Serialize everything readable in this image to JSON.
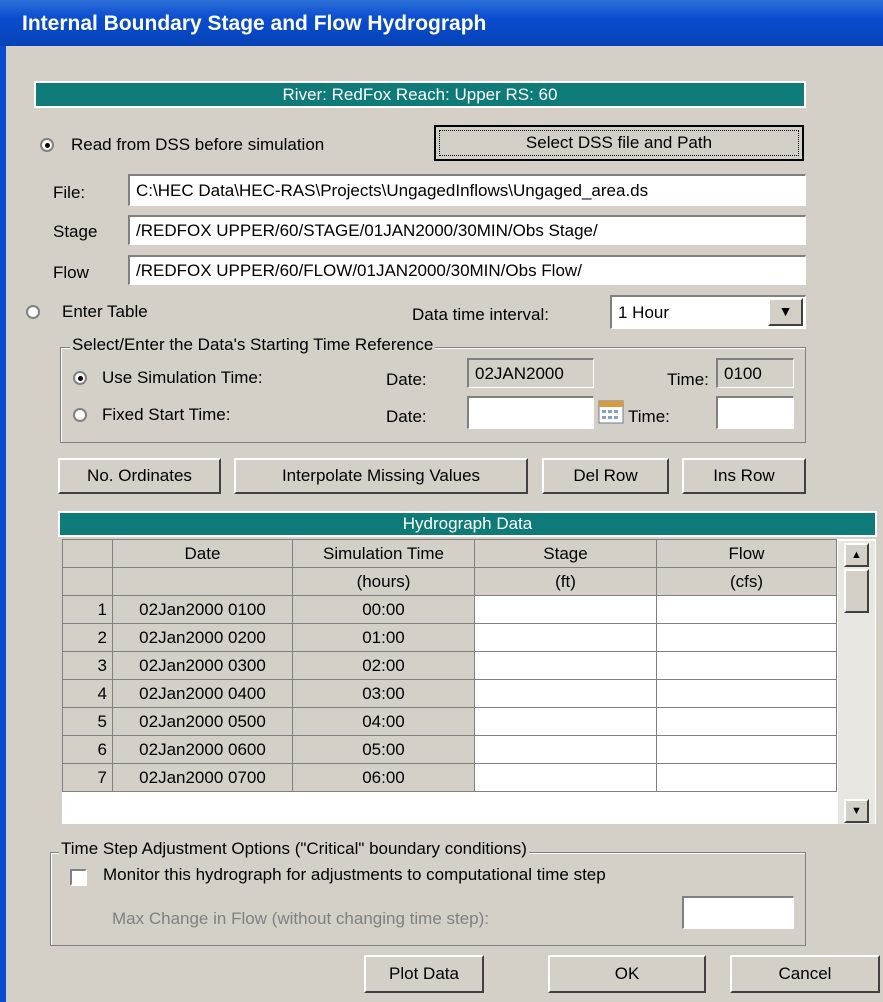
{
  "window": {
    "title": "Internal Boundary Stage and Flow Hydrograph"
  },
  "location_banner": "River: RedFox  Reach: Upper  RS: 60",
  "dss": {
    "radio_label": "Read from DSS before simulation",
    "select_button": "Select DSS file and Path",
    "file_label": "File:",
    "file_value": "C:\\HEC Data\\HEC-RAS\\Projects\\UngagedInflows\\Ungaged_area.ds",
    "stage_label": "Stage",
    "stage_value": "/REDFOX UPPER/60/STAGE/01JAN2000/30MIN/Obs Stage/",
    "flow_label": "Flow",
    "flow_value": "/REDFOX UPPER/60/FLOW/01JAN2000/30MIN/Obs Flow/"
  },
  "table_entry": {
    "radio_label": "Enter Table",
    "interval_label": "Data time interval:",
    "interval_value": "1 Hour"
  },
  "time_ref": {
    "legend": "Select/Enter the Data's Starting Time Reference",
    "use_sim_label": "Use Simulation Time:",
    "fixed_label": "Fixed Start Time:",
    "date_label": "Date:",
    "time_label": "Time:",
    "sim_date": "02JAN2000",
    "sim_time": "0100",
    "fixed_date": "",
    "fixed_time": ""
  },
  "toolbar": {
    "ordinates": "No. Ordinates",
    "interpolate": "Interpolate Missing Values",
    "del_row": "Del Row",
    "ins_row": "Ins Row"
  },
  "grid": {
    "title": "Hydrograph Data",
    "headers": [
      "Date",
      "Simulation Time",
      "Stage",
      "Flow"
    ],
    "units": [
      "",
      "(hours)",
      "(ft)",
      "(cfs)"
    ],
    "rows": [
      {
        "n": "1",
        "date": "02Jan2000 0100",
        "time": "00:00",
        "stage": "",
        "flow": ""
      },
      {
        "n": "2",
        "date": "02Jan2000 0200",
        "time": "01:00",
        "stage": "",
        "flow": ""
      },
      {
        "n": "3",
        "date": "02Jan2000 0300",
        "time": "02:00",
        "stage": "",
        "flow": ""
      },
      {
        "n": "4",
        "date": "02Jan2000 0400",
        "time": "03:00",
        "stage": "",
        "flow": ""
      },
      {
        "n": "5",
        "date": "02Jan2000 0500",
        "time": "04:00",
        "stage": "",
        "flow": ""
      },
      {
        "n": "6",
        "date": "02Jan2000 0600",
        "time": "05:00",
        "stage": "",
        "flow": ""
      },
      {
        "n": "7",
        "date": "02Jan2000 0700",
        "time": "06:00",
        "stage": "",
        "flow": ""
      }
    ]
  },
  "adjust": {
    "legend": "Time Step Adjustment Options (\"Critical\" boundary conditions)",
    "monitor_label": "Monitor this hydrograph for adjustments to computational time step",
    "max_change_label": "Max Change in Flow (without changing time step):",
    "max_change_value": ""
  },
  "footer": {
    "plot": "Plot Data",
    "ok": "OK",
    "cancel": "Cancel"
  }
}
